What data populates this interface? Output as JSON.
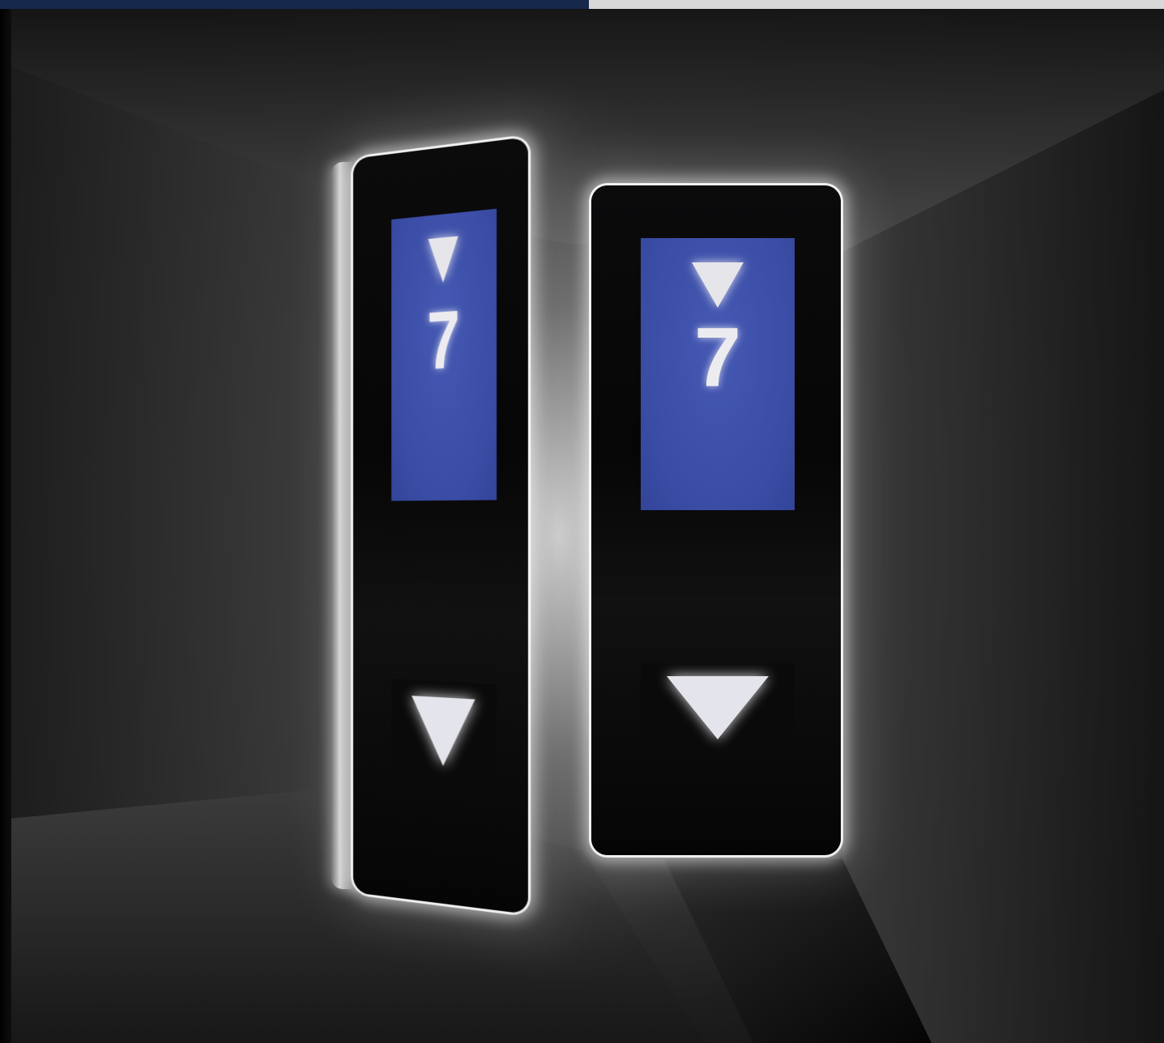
{
  "photo": {
    "colors": {
      "top_bar_left": "#16284b",
      "top_bar_right": "#d8d8d8",
      "screen_blue": "#3c4fa8",
      "glyph_white": "#e6e6ea",
      "panel_black": "#080808"
    }
  },
  "panels": [
    {
      "floor": "7",
      "screen_arrow_icon": "down-arrow-icon",
      "call_button_icon": "down-arrow-icon"
    },
    {
      "floor": "7",
      "screen_arrow_icon": "down-arrow-icon",
      "call_button_icon": "down-arrow-icon"
    }
  ]
}
